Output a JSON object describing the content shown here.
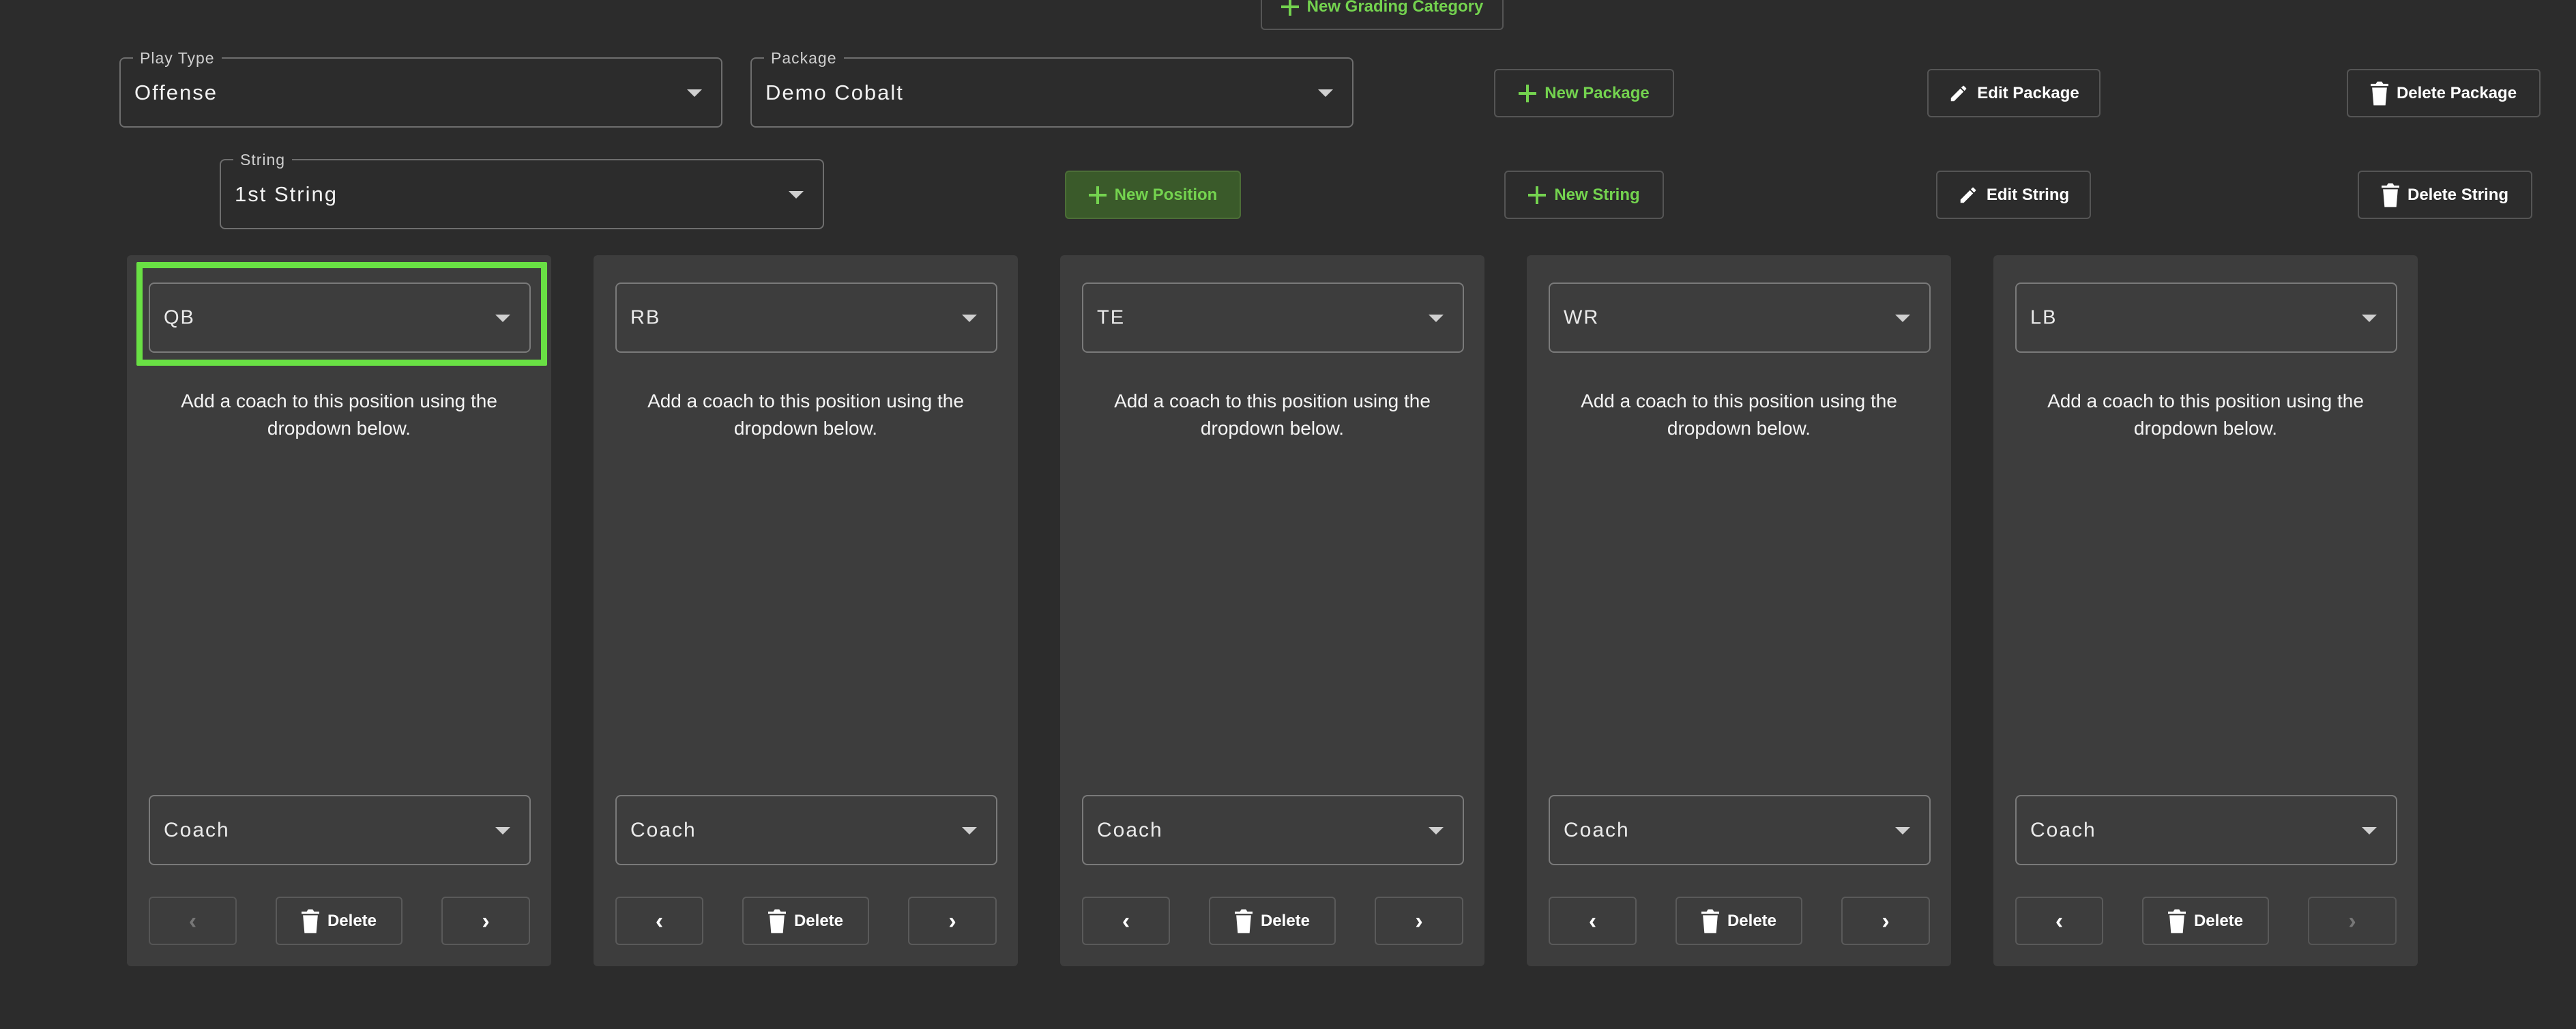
{
  "header": {
    "new_grading_category": "New Grading Category",
    "play_type": {
      "label": "Play Type",
      "value": "Offense"
    },
    "package": {
      "label": "Package",
      "value": "Demo Cobalt"
    },
    "string": {
      "label": "String",
      "value": "1st String"
    },
    "new_package": "New Package",
    "edit_package": "Edit Package",
    "delete_package": "Delete Package",
    "new_position": "New Position",
    "new_string": "New String",
    "edit_string": "Edit String",
    "delete_string": "Delete String"
  },
  "cards": [
    {
      "position": "QB",
      "hint": "Add a coach to this position using the dropdown below.",
      "coach": "Coach",
      "delete": "Delete",
      "prev": "‹",
      "next": "›"
    },
    {
      "position": "RB",
      "hint": "Add a coach to this position using the dropdown below.",
      "coach": "Coach",
      "delete": "Delete",
      "prev": "‹",
      "next": "›"
    },
    {
      "position": "TE",
      "hint": "Add a coach to this position using the dropdown below.",
      "coach": "Coach",
      "delete": "Delete",
      "prev": "‹",
      "next": "›"
    },
    {
      "position": "WR",
      "hint": "Add a coach to this position using the dropdown below.",
      "coach": "Coach",
      "delete": "Delete",
      "prev": "‹",
      "next": "›"
    },
    {
      "position": "LB",
      "hint": "Add a coach to this position using the dropdown below.",
      "coach": "Coach",
      "delete": "Delete",
      "prev": "‹",
      "next": "›"
    }
  ],
  "colors": {
    "accent": "#74d34f",
    "highlight": "#69e044",
    "background": "#2c2c2c",
    "card": "#3d3d3d"
  },
  "icons": {
    "add": "plus-icon",
    "edit": "pencil-icon",
    "delete": "trash-icon",
    "dropdown": "caret-down-icon"
  }
}
